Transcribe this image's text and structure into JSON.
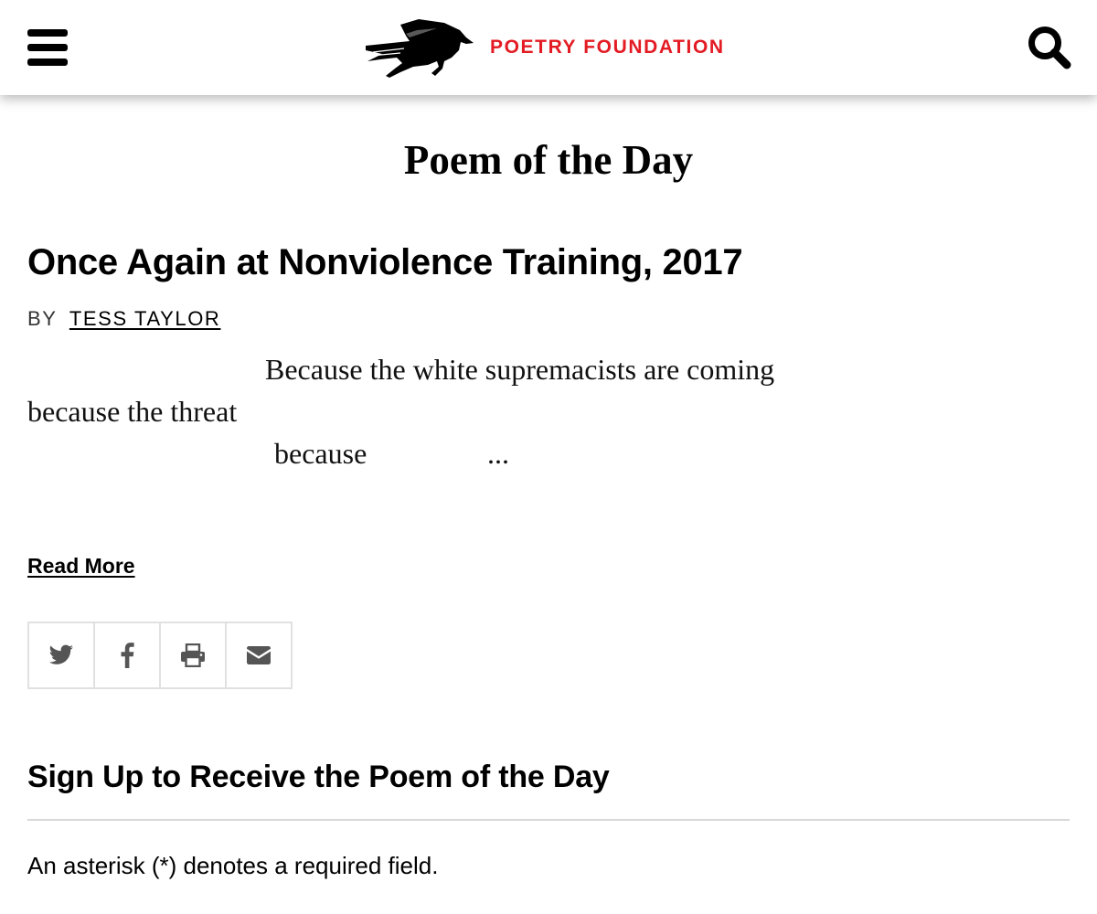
{
  "header": {
    "menu_icon": "hamburger-menu-icon",
    "logo_icon": "pegasus-icon",
    "logo_text": "POETRY FOUNDATION",
    "search_icon": "search-icon",
    "brand_color": "#e31b23"
  },
  "page": {
    "heading": "Poem of the Day"
  },
  "poem": {
    "title": "Once Again at Nonviolence Training, 2017",
    "by_label": "BY",
    "author": "TESS TAYLOR",
    "excerpt": {
      "line1": "Because the white supremacists are coming",
      "line2": "because the threat",
      "line3_word": "because",
      "line3_ellipsis": "..."
    },
    "read_more_label": "Read More"
  },
  "share": {
    "buttons": [
      {
        "name": "twitter",
        "icon": "twitter-icon"
      },
      {
        "name": "facebook",
        "icon": "facebook-icon"
      },
      {
        "name": "print",
        "icon": "print-icon"
      },
      {
        "name": "email",
        "icon": "envelope-icon"
      }
    ]
  },
  "signup": {
    "heading": "Sign Up to Receive the Poem of the Day",
    "required_note": "An asterisk (*) denotes a required field."
  }
}
